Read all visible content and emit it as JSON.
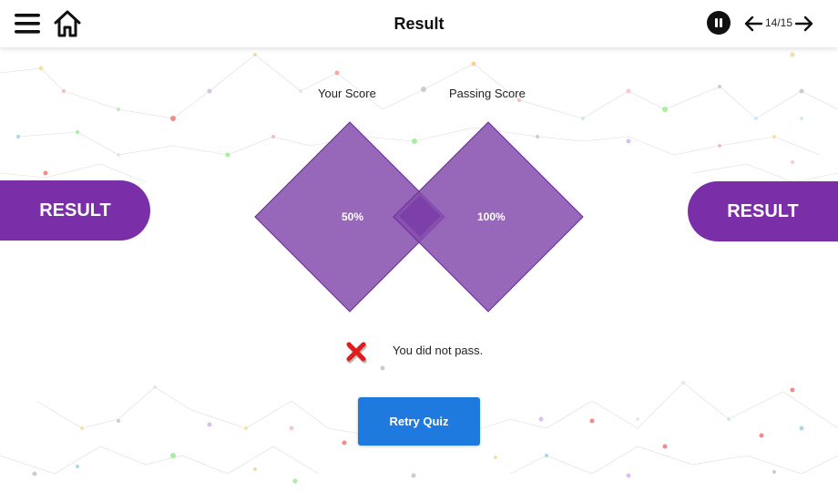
{
  "header": {
    "title": "Result",
    "page_indicator": "14/15"
  },
  "icons": {
    "menu": "hamburger-menu-icon",
    "home": "home-icon",
    "pause": "pause-icon",
    "prev": "arrow-left-icon",
    "next": "arrow-right-icon",
    "status": "red-x-icon"
  },
  "side_labels": {
    "left": "RESULT",
    "right": "RESULT"
  },
  "scores": {
    "your_label": "Your Score",
    "your_value": "50%",
    "passing_label": "Passing Score",
    "passing_value": "100%"
  },
  "status": {
    "message": "You did not pass."
  },
  "actions": {
    "retry_label": "Retry Quiz"
  },
  "colors": {
    "accent_purple": "#7a2fa8",
    "diamond_purple": "#854cad",
    "button_blue": "#1f7ae0",
    "fail_red": "#e01b1b"
  }
}
